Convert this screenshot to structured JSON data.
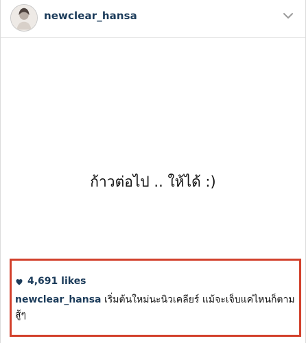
{
  "post": {
    "username": "newclear_hansa",
    "image_text": "ก้าวต่อไป .. ให้ได้ :)",
    "likes": "4,691 likes",
    "caption_user": "newclear_hansa",
    "caption_text": " เริ่มต้นใหม่นะนิวเคลียร์ แม้จะเจ็บแค่ไหนก็ตาม สู้ๆ"
  },
  "icons": {
    "avatar": "profile-avatar",
    "more": "chevron-down-icon",
    "like": "heart-icon"
  },
  "colors": {
    "username": "#1b3b5a",
    "highlight_border": "#d2402b",
    "text": "#111111"
  }
}
